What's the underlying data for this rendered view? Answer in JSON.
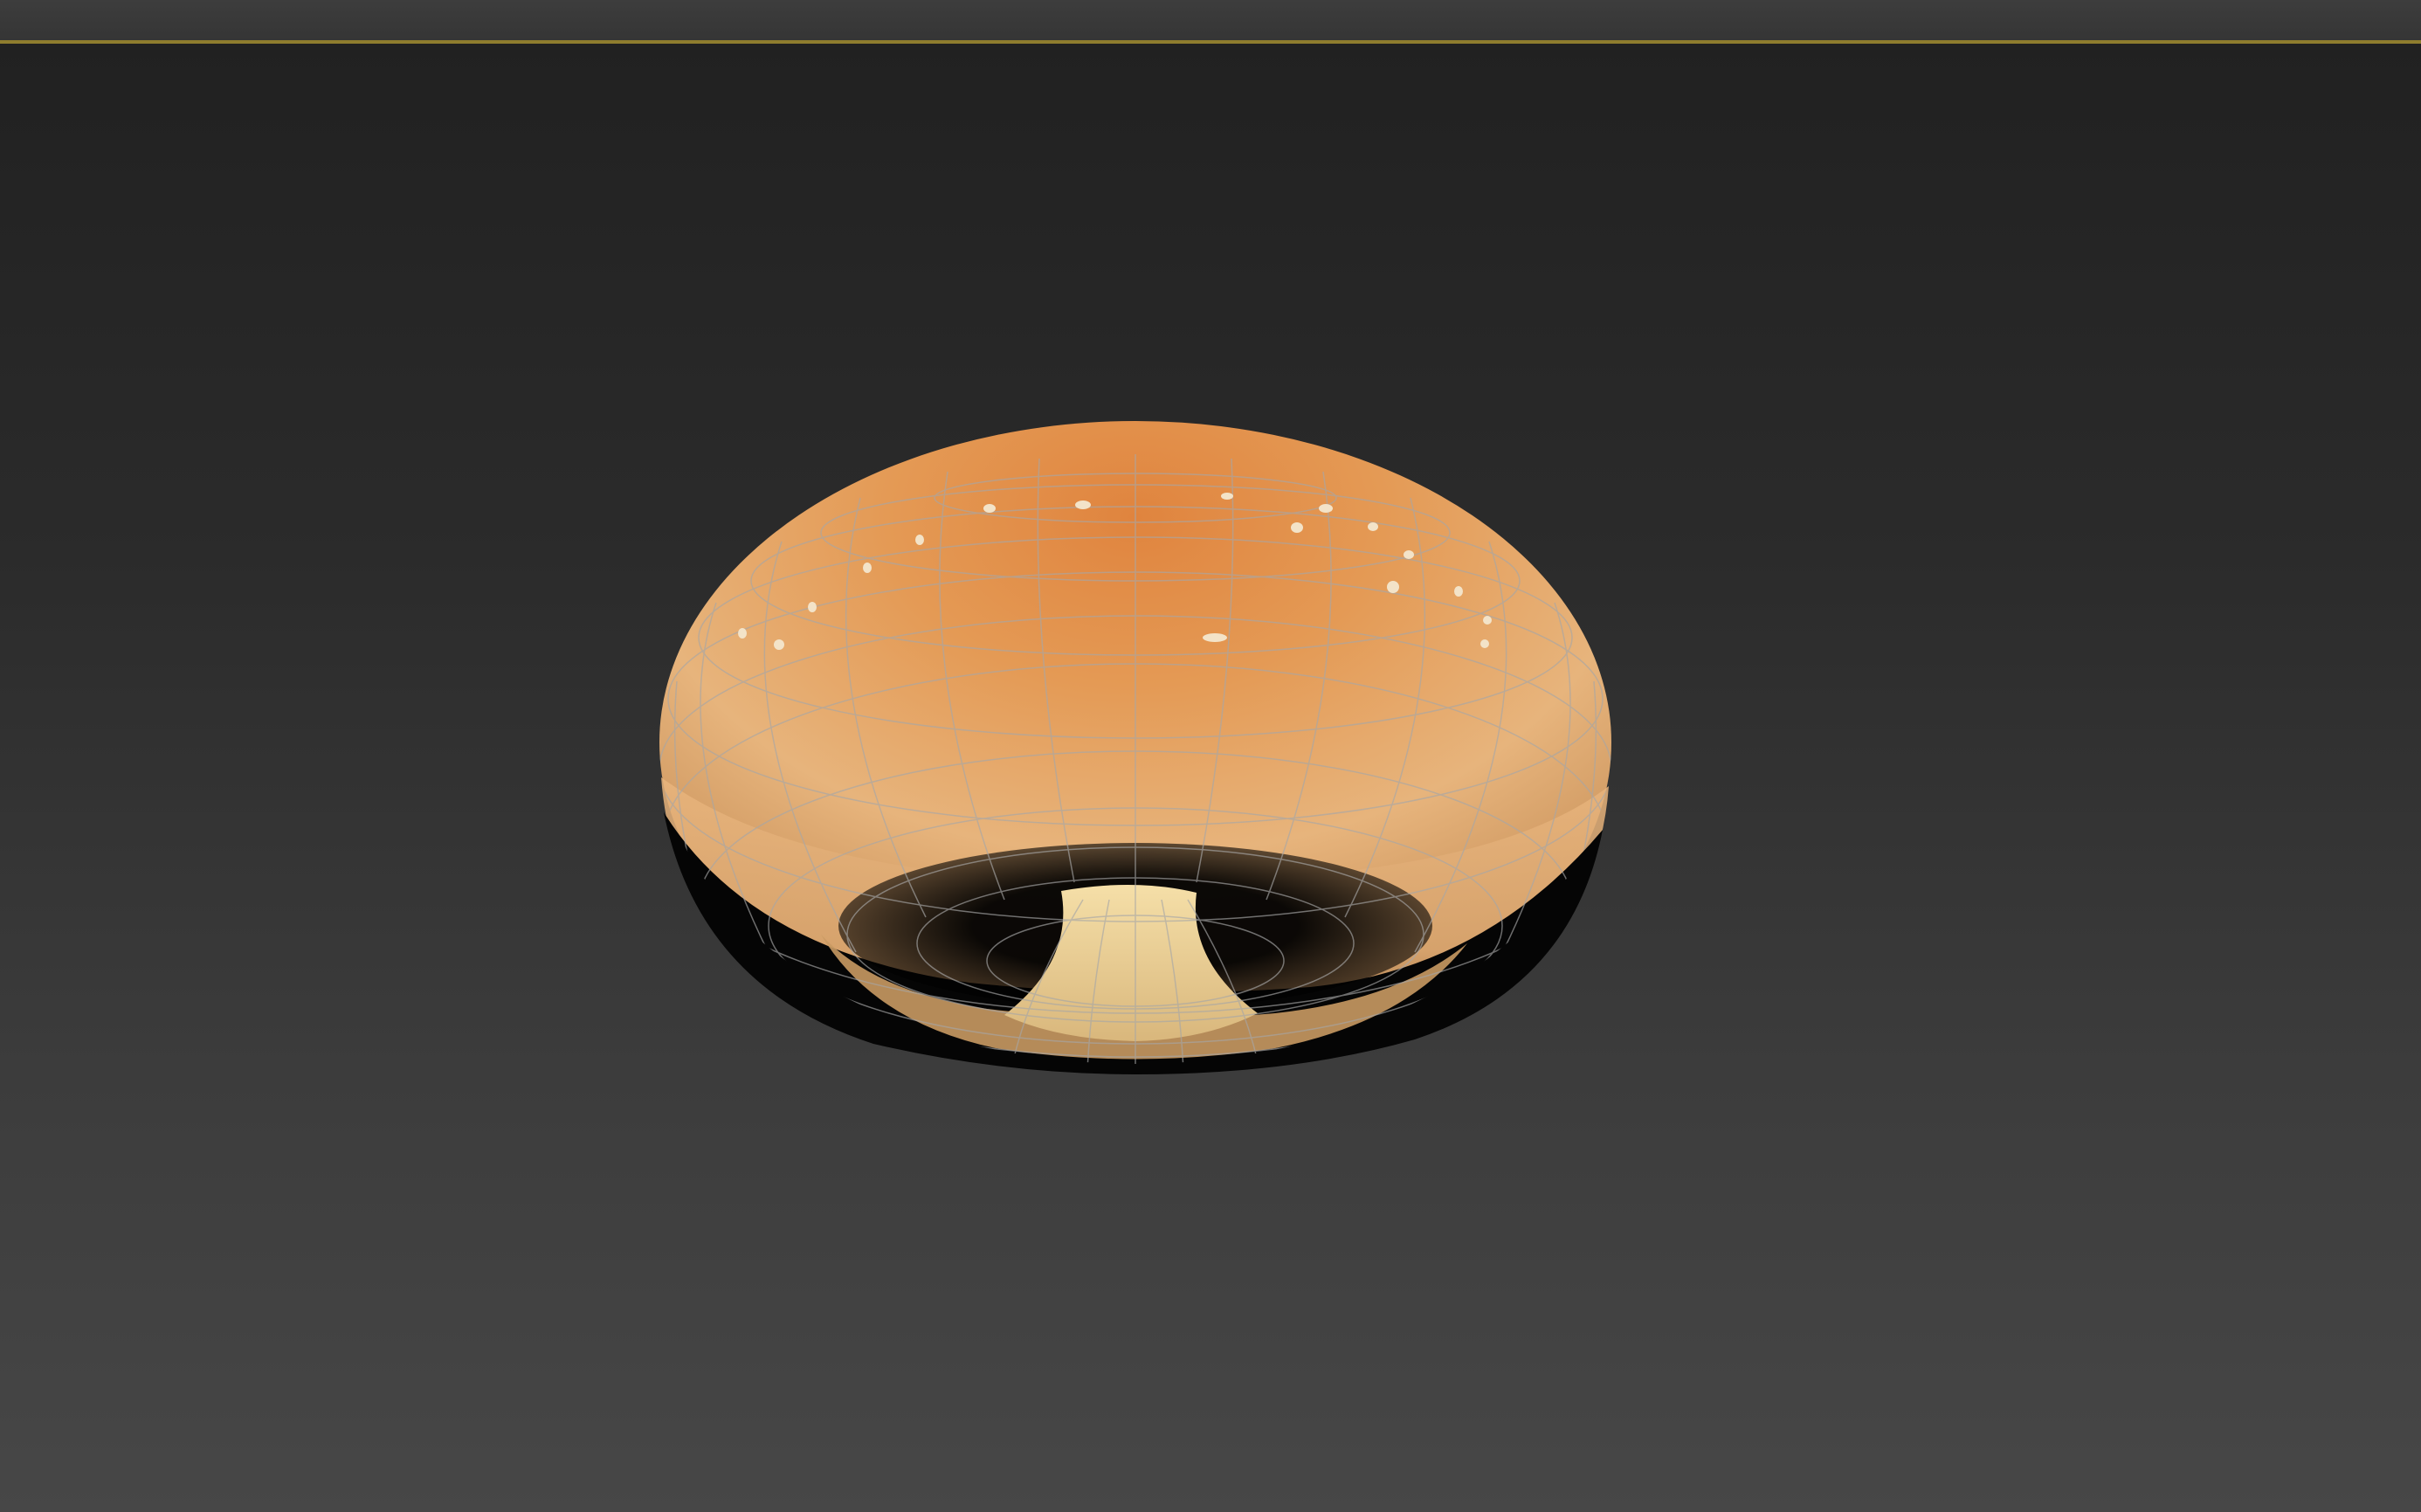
{
  "viewport": {
    "background_top": "#212121",
    "background_bottom": "#474747",
    "active_border_color": "#8f7d2e"
  },
  "model": {
    "object": "bun-torus-icon",
    "top_color": "#d97a33",
    "side_color": "#e6b27a",
    "inner_color": "#f0d6a0",
    "wireframe_color": "#9a9a9a"
  }
}
